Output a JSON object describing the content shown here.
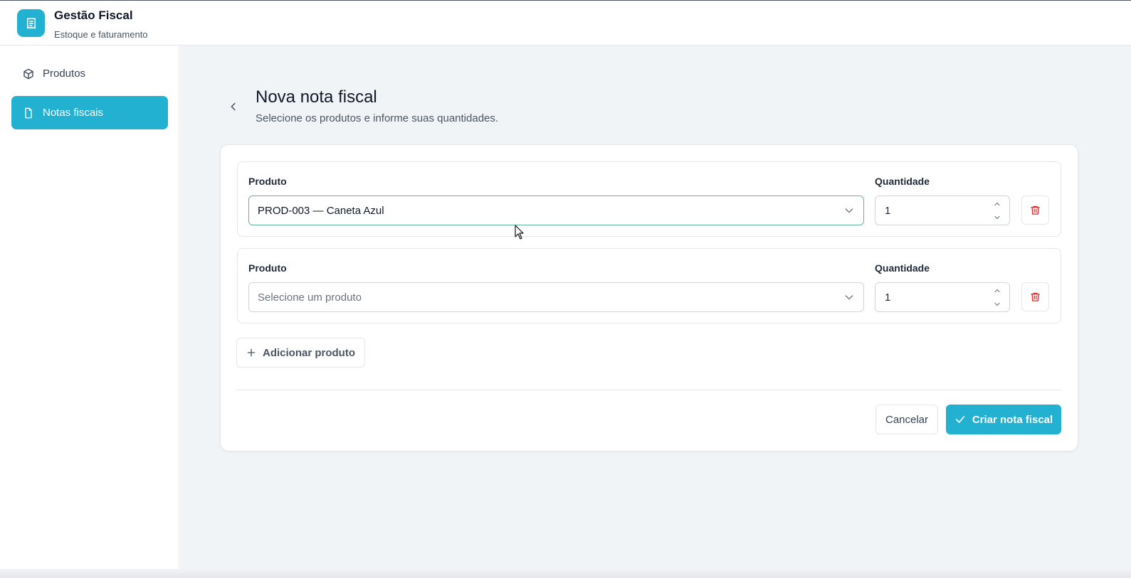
{
  "app": {
    "title": "Gestão Fiscal",
    "subtitle": "Estoque e faturamento",
    "icon": "receipt-icon"
  },
  "sidebar": {
    "items": [
      {
        "label": "Produtos",
        "icon": "package-icon",
        "active": false
      },
      {
        "label": "Notas fiscais",
        "icon": "file-icon",
        "active": true
      }
    ]
  },
  "page": {
    "title": "Nova nota fiscal",
    "subtitle": "Selecione os produtos e informe suas quantidades."
  },
  "form": {
    "product_label": "Produto",
    "quantity_label": "Quantidade",
    "rows": [
      {
        "product_value": "PROD-003 — Caneta Azul",
        "product_placeholder": "",
        "quantity": "1"
      },
      {
        "product_value": "",
        "product_placeholder": "Selecione um produto",
        "quantity": "1"
      }
    ],
    "add_label": "Adicionar produto",
    "cancel_label": "Cancelar",
    "submit_label": "Criar nota fiscal"
  },
  "colors": {
    "accent": "#22b1d0",
    "delete": "#dc2626",
    "background": "#f1f4f7"
  }
}
